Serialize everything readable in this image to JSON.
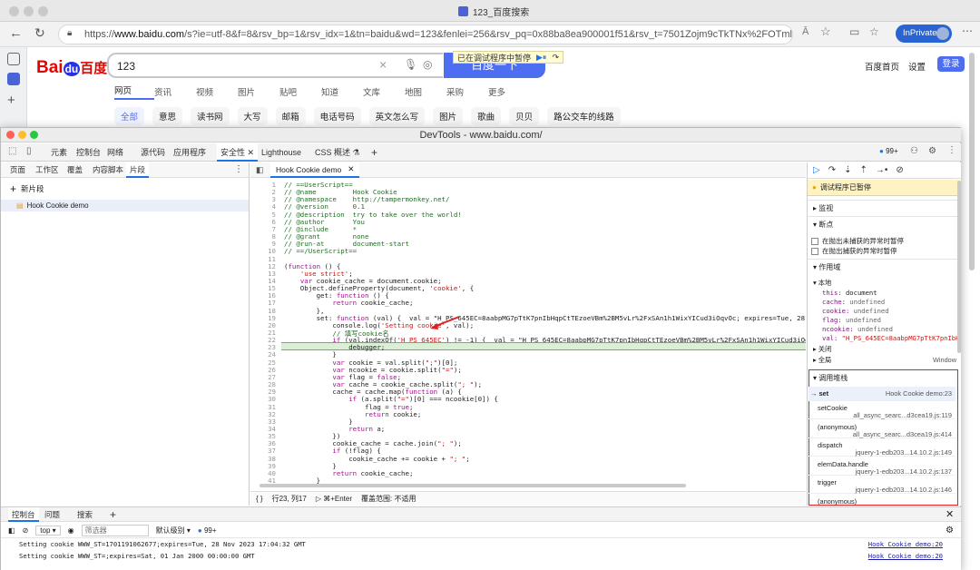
{
  "browser": {
    "tab_title": "123_百度搜索",
    "url_prefix": "https://",
    "url_host": "www.baidu.com",
    "url_rest": "/s?ie=utf-8&f=8&rsv_bp=1&rsv_idx=1&tn=baidu&wd=123&fenlei=256&rsv_pq=0x88ba8ea900001f51&rsv_t=7501Zojm9cTkTNx%2FOTmloEHmchC1eEz2hzExQif...",
    "inprivate": "InPrivate",
    "reader_icon": "Ā",
    "accent": "#2a63d4"
  },
  "baidu": {
    "logo_bai": "Bai",
    "logo_du": "du",
    "logo_cn": "百度",
    "query": "123",
    "search_btn": "百度一下",
    "paused_banner": "已在调试程序中暂停",
    "top_links": [
      "百度首页",
      "设置"
    ],
    "login": "登录",
    "tabs": [
      "网页",
      "资讯",
      "视频",
      "图片",
      "贴吧",
      "知道",
      "文库",
      "地图",
      "采购",
      "更多"
    ],
    "chips": [
      "全部",
      "意思",
      "读书网",
      "大写",
      "邮箱",
      "电话号码",
      "英文怎么写",
      "图片",
      "歌曲",
      "贝贝",
      "路公交车的线路"
    ]
  },
  "devtools": {
    "title": "DevTools - www.baidu.com/",
    "tabs": [
      "元素",
      "控制台",
      "网络",
      "源代码",
      "应用程序",
      "安全性",
      "Lighthouse",
      "CSS 概述"
    ],
    "issues_count": "99+",
    "left_tabs": [
      "页面",
      "工作区",
      "覆盖",
      "内容脚本",
      "片段"
    ],
    "new_snippet": "新片段",
    "snippet_name": "Hook Cookie demo",
    "editor_tab": "Hook Cookie demo",
    "code_lines": [
      "// ==UserScript==",
      "// @name         Hook Cookie",
      "// @namespace    http://tampermonkey.net/",
      "// @version      0.1",
      "// @description  try to take over the world!",
      "// @author       You",
      "// @include      *",
      "// @grant        none",
      "// @run-at       document-start",
      "// ==/UserScript==",
      "",
      "(function () {",
      "    'use strict';",
      "    var cookie_cache = document.cookie;",
      "    Object.defineProperty(document, 'cookie', {",
      "        get: function () {",
      "            return cookie_cache;",
      "        },",
      "        set: function (val) {  val = \"H_PS_645EC=8aabpMG7pTtK7pnIbHqpCtTEzoeVBm%2BM5vLr%2FxSAn1h1WixYICud3iOqvOc; expires=Tue, 28 Nov 2023",
      "            console.log('Setting cookie', val);",
      "            // 填写cookie名",
      "            if (val.indexOf('H_PS_645EC') != -1) {  val = \"H_PS_645EC=8aabpMG7pTtK7pnIbHqpCtTEzoeVBm%2BM5vLr%2FxSAn1h1WixYICud3iOqvOc; exp",
      "                debugger;",
      "            }",
      "            var cookie = val.split(\";\")[0];",
      "            var ncookie = cookie.split(\"=\");",
      "            var flag = false;",
      "            var cache = cookie_cache.split(\"; \");",
      "            cache = cache.map(function (a) {",
      "                if (a.split(\"=\")[0] === ncookie[0]) {",
      "                    flag = true;",
      "                    return cookie;",
      "                }",
      "                return a;",
      "            })",
      "            cookie_cache = cache.join(\"; \");",
      "            if (!flag) {",
      "                cookie_cache += cookie + \"; \";",
      "            }",
      "            return cookie_cache;",
      "        }"
    ],
    "status": {
      "braces": "{ }",
      "position": "行23, 列17",
      "run": "⌘+Enter",
      "coverage": "覆盖范围: 不适用"
    },
    "paused_label": "调试程序已暂停",
    "watch": "监视",
    "breakpoints": "断点",
    "bp_options": [
      "在抛出未捕获的异常时暂停",
      "在抛出捕获的异常时暂停"
    ],
    "scope": "作用域",
    "scope_local": "本地",
    "scope_vars": [
      {
        "k": "this",
        "v": "document"
      },
      {
        "k": "cache",
        "v": "undefined"
      },
      {
        "k": "cookie",
        "v": "undefined"
      },
      {
        "k": "flag",
        "v": "undefined"
      },
      {
        "k": "ncookie",
        "v": "undefined"
      },
      {
        "k": "val",
        "v": "\"H_PS_645EC=8aabpMG7pTtK7pnIbHqp"
      }
    ],
    "scope_closure": "关闭",
    "scope_global": "全局",
    "scope_global_val": "Window",
    "call_stack": "调用堆栈",
    "stack": [
      {
        "fn": "set",
        "loc": "Hook Cookie demo:23"
      },
      {
        "fn": "setCookie",
        "loc": "all_async_searc...d3cea19.js:119"
      },
      {
        "fn": "(anonymous)",
        "loc": "all_async_searc...d3cea19.js:414"
      },
      {
        "fn": "dispatch",
        "loc": "jquery-1-edb203...14.10.2.js:149"
      },
      {
        "fn": "elemData.handle",
        "loc": "jquery-1-edb203...14.10.2.js:137"
      },
      {
        "fn": "trigger",
        "loc": "jquery-1-edb203...14.10.2.js:146"
      },
      {
        "fn": "(anonymous)",
        "loc": "jquery-1-edb203...14.10.2.js:167"
      }
    ],
    "console_tabs": [
      "控制台",
      "问题",
      "搜索"
    ],
    "context": "top",
    "filter_placeholder": "筛选器",
    "level": "默认级别",
    "console_issues": "99+",
    "console_lines": [
      {
        "text": "Setting cookie WWW_ST=1701191062677;expires=Tue, 28 Nov 2023 17:04:32 GMT",
        "src": "Hook Cookie demo:20"
      },
      {
        "text": "Setting cookie WWW_ST=;expires=Sat, 01 Jan 2000 00:00:00 GMT",
        "src": "Hook Cookie demo:20"
      }
    ]
  }
}
